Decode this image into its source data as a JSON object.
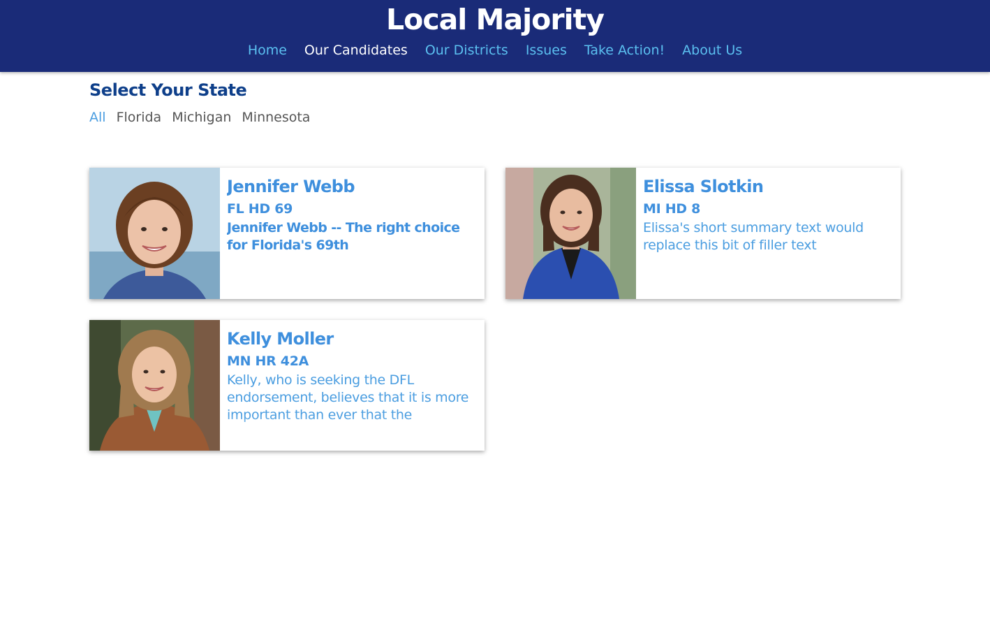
{
  "header": {
    "site_title": "Local Majority",
    "background_color": "#1a2b78",
    "nav": [
      {
        "label": "Home",
        "active": false
      },
      {
        "label": "Our Candidates",
        "active": true
      },
      {
        "label": "Our Districts",
        "active": false
      },
      {
        "label": "Issues",
        "active": false
      },
      {
        "label": "Take Action!",
        "active": false
      },
      {
        "label": "About Us",
        "active": false
      }
    ]
  },
  "state_filter": {
    "heading": "Select Your State",
    "options": [
      {
        "label": "All",
        "active": true
      },
      {
        "label": "Florida",
        "active": false
      },
      {
        "label": "Michigan",
        "active": false
      },
      {
        "label": "Minnesota",
        "active": false
      }
    ]
  },
  "candidates": [
    {
      "name": "Jennifer Webb",
      "district": "FL HD 69",
      "summary": "Jennifer Webb -- The right choice for Florida's 69th",
      "photo_icon": "candidate-portrait"
    },
    {
      "name": "Elissa Slotkin",
      "district": "MI HD 8",
      "summary": "Elissa's short summary text would replace this bit of filler text",
      "photo_icon": "candidate-portrait"
    },
    {
      "name": "Kelly Moller",
      "district": "MN HR 42A",
      "summary": "Kelly, who is seeking the DFL endorsement, believes that it is more important than ever that the",
      "photo_icon": "candidate-portrait"
    }
  ],
  "colors": {
    "accent": "#3e8fdd",
    "nav_link": "#5bc0f0",
    "heading": "#0e3f8a"
  }
}
